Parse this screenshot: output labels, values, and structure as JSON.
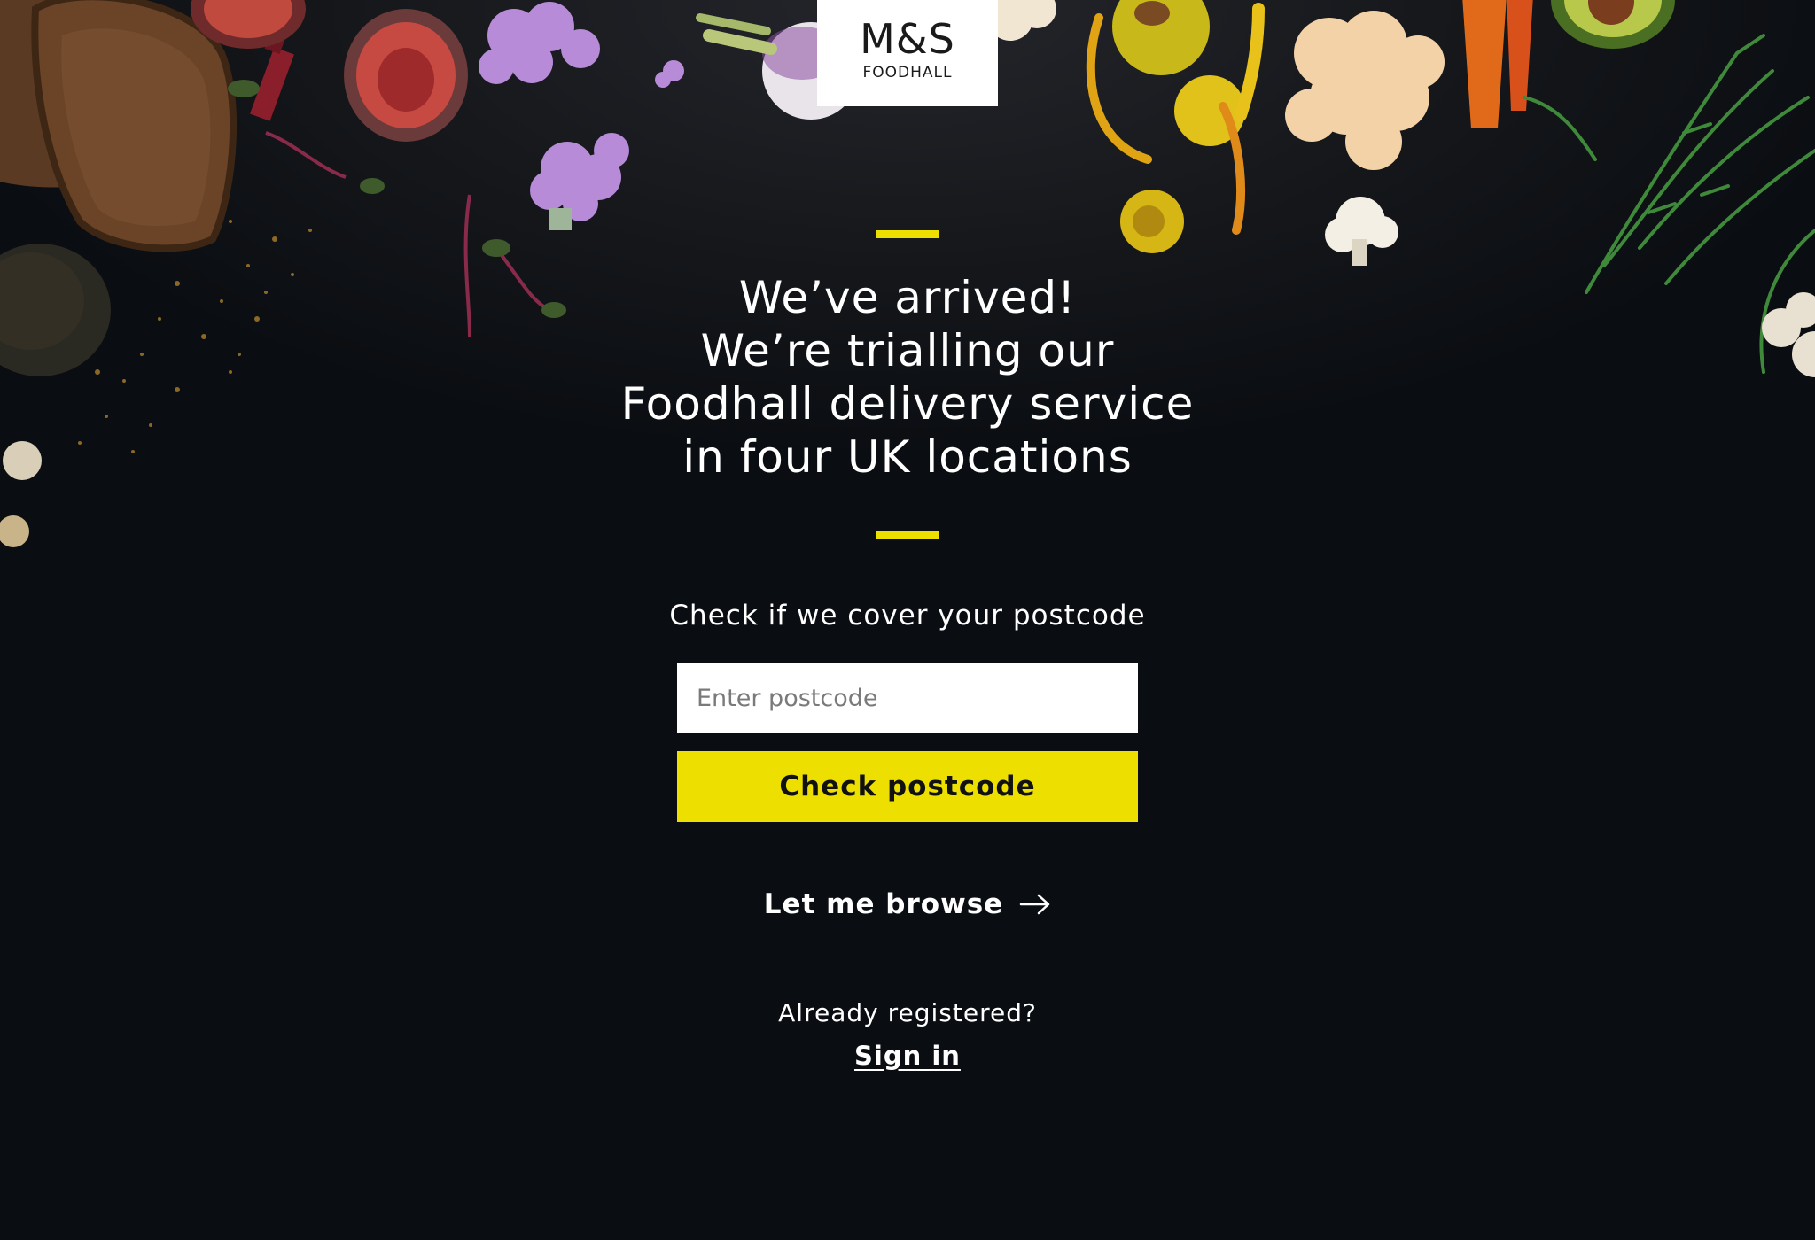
{
  "brand": {
    "logo_mark": "M&S",
    "logo_sub": "FOODHALL"
  },
  "colors": {
    "background": "#0a0d11",
    "accent": "#ede000",
    "text": "#ffffff"
  },
  "hero": {
    "headline_lines": [
      "We’ve arrived!",
      "We’re trialling our",
      "Foodhall delivery service",
      "in four UK locations"
    ]
  },
  "postcode_check": {
    "subtitle": "Check if we cover your postcode",
    "input_value": "",
    "input_placeholder": "Enter postcode",
    "button_label": "Check postcode"
  },
  "browse": {
    "label": "Let me browse",
    "icon": "arrow-right-icon"
  },
  "account": {
    "registered_text": "Already registered?",
    "signin_label": "Sign in"
  },
  "decorations": {
    "food_items": [
      "bread-slices",
      "figs",
      "purple-cauliflower",
      "radicchio",
      "microgreens",
      "avocado",
      "turnip",
      "spice-dust",
      "yellow-tomatoes",
      "carrots",
      "cauliflower",
      "samphire",
      "rhubarb"
    ]
  }
}
